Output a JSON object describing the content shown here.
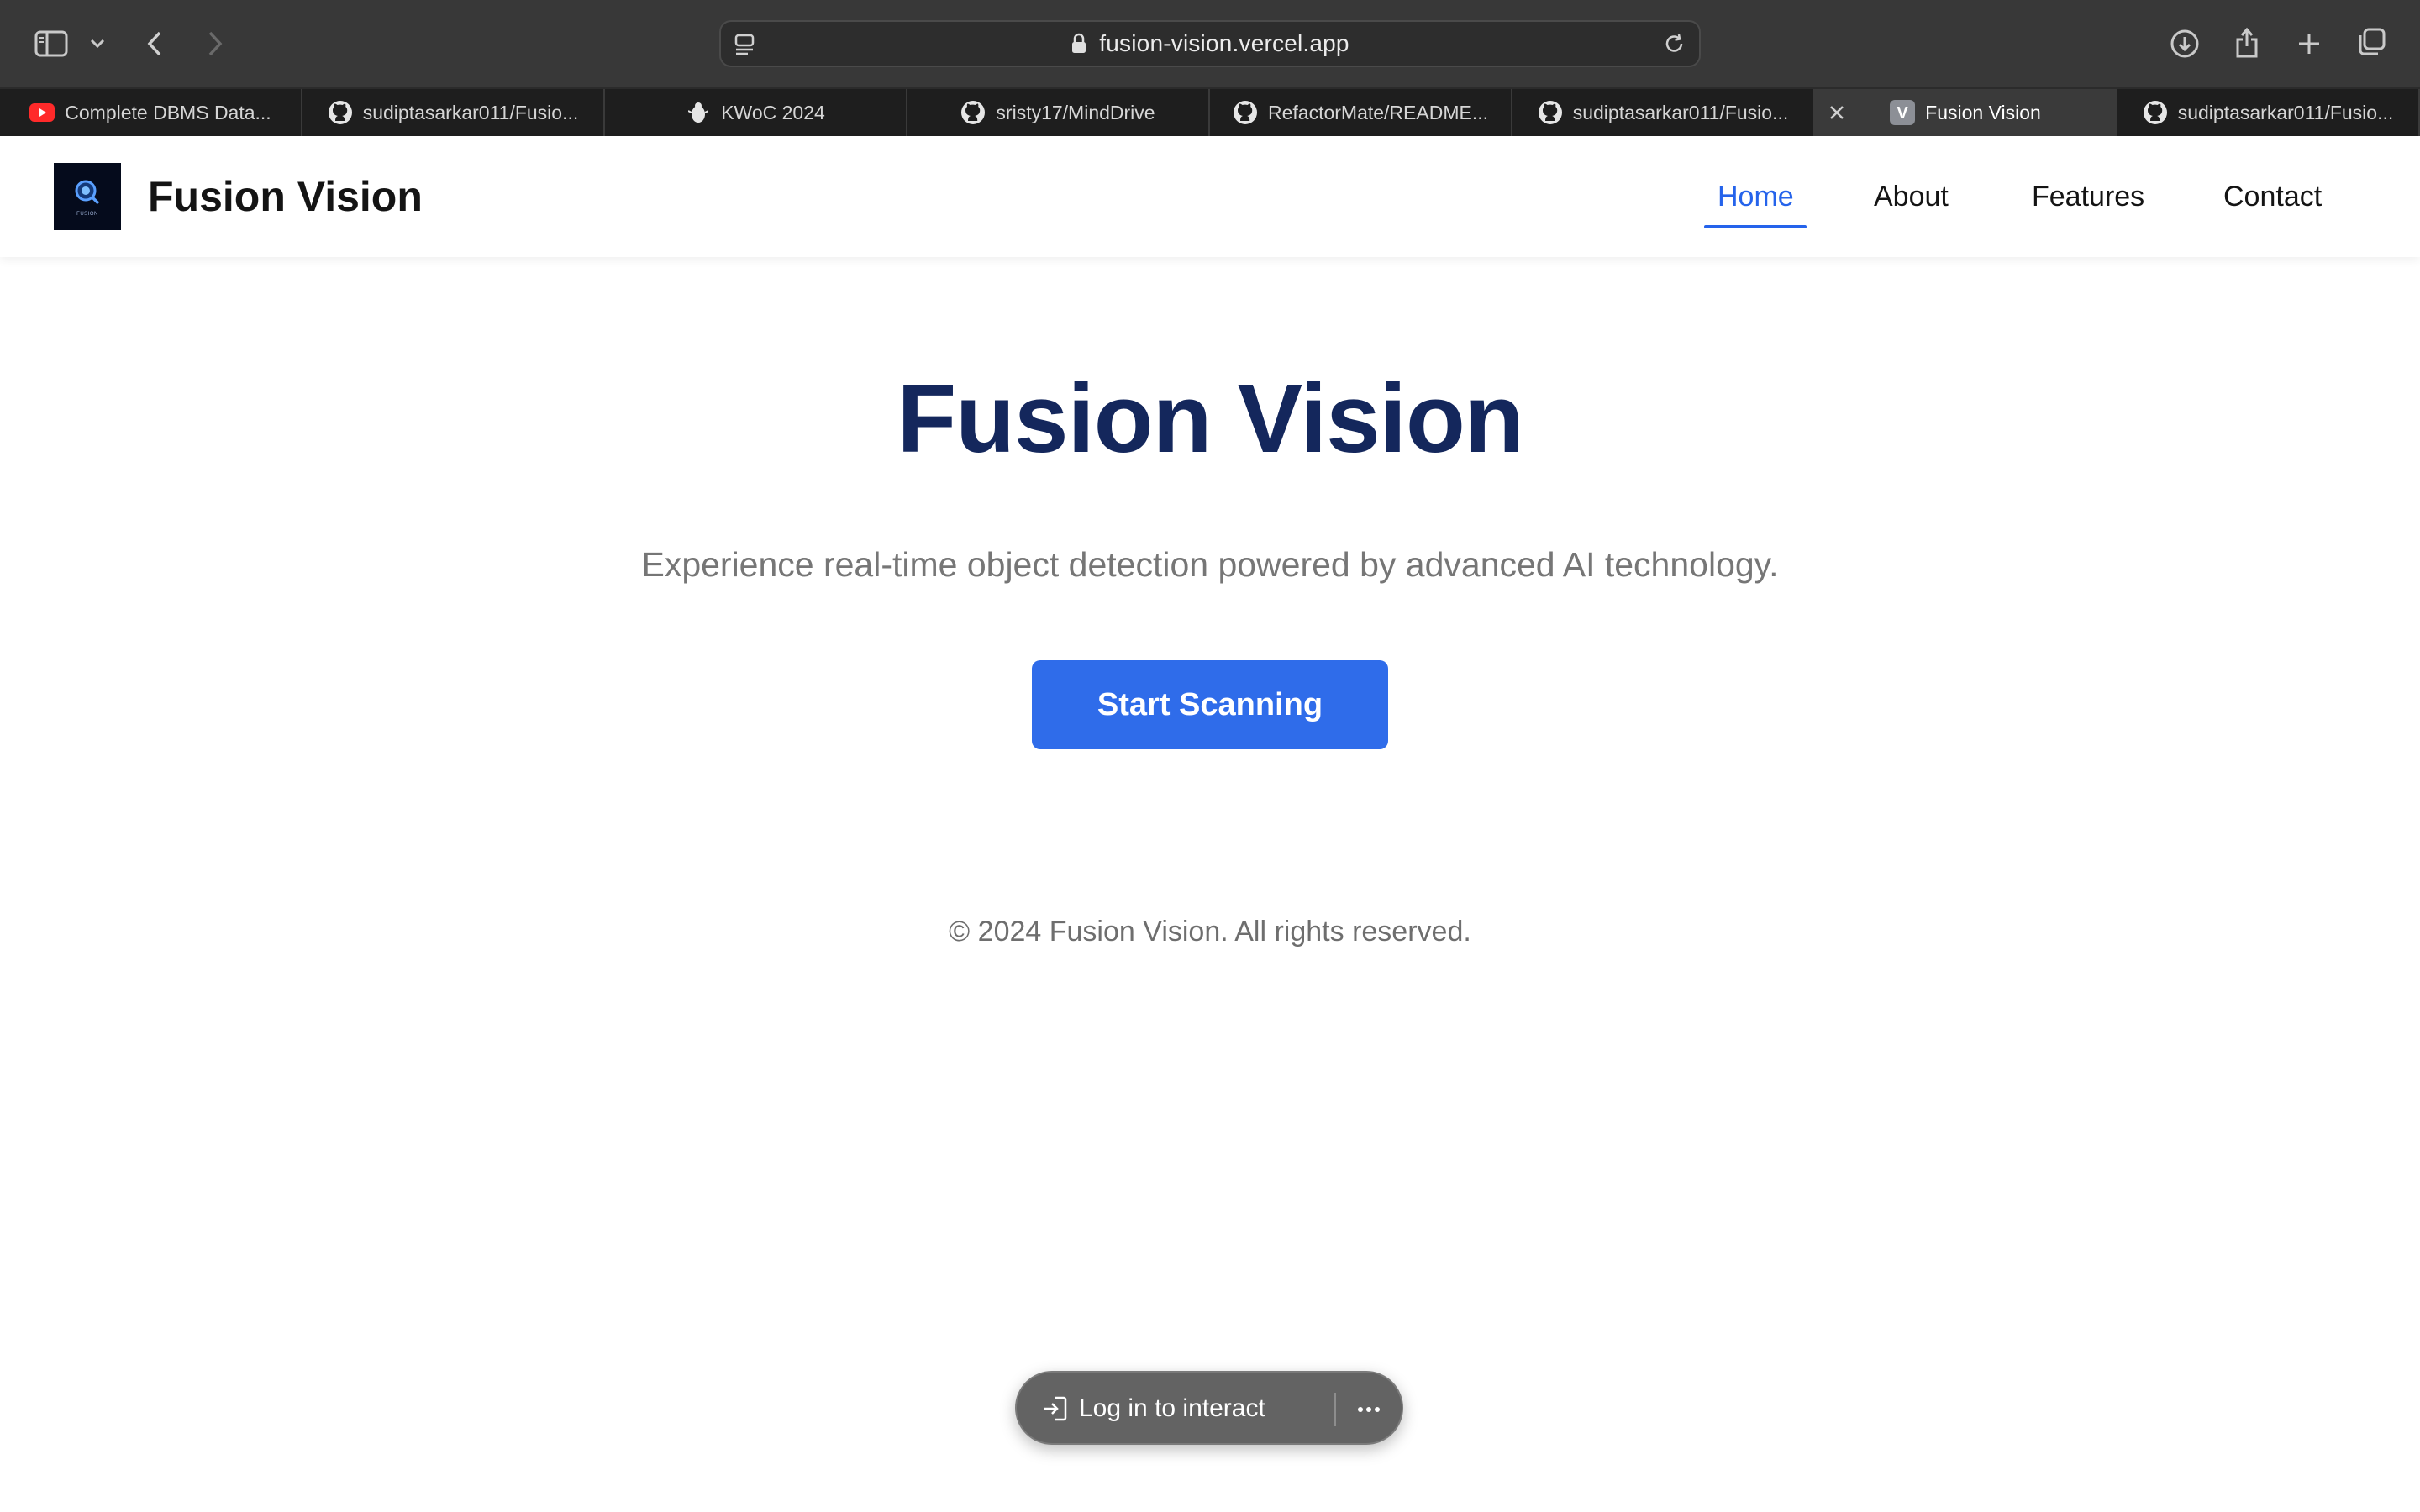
{
  "browser": {
    "url": "fusion-vision.vercel.app",
    "tabs": [
      {
        "label": "Complete DBMS Data...",
        "icon": "youtube-icon",
        "active": false
      },
      {
        "label": "sudiptasarkar011/Fusio...",
        "icon": "github-icon",
        "active": false
      },
      {
        "label": "KWoC 2024",
        "icon": "kwoc-icon",
        "active": false
      },
      {
        "label": "sristy17/MindDrive",
        "icon": "github-icon",
        "active": false
      },
      {
        "label": "RefactorMate/README...",
        "icon": "github-icon",
        "active": false
      },
      {
        "label": "sudiptasarkar011/Fusio...",
        "icon": "github-icon",
        "active": false
      },
      {
        "label": "Fusion Vision",
        "icon": "vercel-v-icon",
        "active": true
      },
      {
        "label": "sudiptasarkar011/Fusio...",
        "icon": "github-icon",
        "active": false
      }
    ]
  },
  "header": {
    "brand": "Fusion Vision",
    "logo_caption": "FUSION",
    "nav": [
      {
        "label": "Home",
        "active": true
      },
      {
        "label": "About",
        "active": false
      },
      {
        "label": "Features",
        "active": false
      },
      {
        "label": "Contact",
        "active": false
      }
    ]
  },
  "hero": {
    "title": "Fusion Vision",
    "subtitle": "Experience real-time object detection powered by advanced AI technology.",
    "cta": "Start Scanning"
  },
  "footer": {
    "copyright": "© 2024 Fusion Vision. All rights reserved."
  },
  "overlay": {
    "login_label": "Log in to interact"
  },
  "colors": {
    "accent": "#2563eb",
    "title": "#14275c",
    "button": "#2f6cea"
  }
}
